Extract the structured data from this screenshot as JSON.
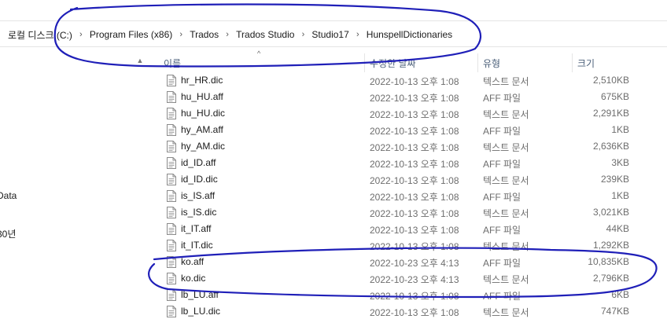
{
  "address": {
    "crumbs": [
      "로컬 디스크 (C:)",
      "Program Files (x86)",
      "Trados",
      "Trados Studio",
      "Studio17",
      "HunspellDictionaries"
    ],
    "separator": "›"
  },
  "nav": {
    "fragment_1": "Data",
    "fragment_2": "30년"
  },
  "columns": {
    "name": "이름",
    "date": "수정한 날짜",
    "type": "유형",
    "size": "크기"
  },
  "files": [
    {
      "name": "hr_HR.dic",
      "date": "2022-10-13 오후 1:08",
      "type": "텍스트 문서",
      "size": "2,510KB"
    },
    {
      "name": "hu_HU.aff",
      "date": "2022-10-13 오후 1:08",
      "type": "AFF 파일",
      "size": "675KB"
    },
    {
      "name": "hu_HU.dic",
      "date": "2022-10-13 오후 1:08",
      "type": "텍스트 문서",
      "size": "2,291KB"
    },
    {
      "name": "hy_AM.aff",
      "date": "2022-10-13 오후 1:08",
      "type": "AFF 파일",
      "size": "1KB"
    },
    {
      "name": "hy_AM.dic",
      "date": "2022-10-13 오후 1:08",
      "type": "텍스트 문서",
      "size": "2,636KB"
    },
    {
      "name": "id_ID.aff",
      "date": "2022-10-13 오후 1:08",
      "type": "AFF 파일",
      "size": "3KB"
    },
    {
      "name": "id_ID.dic",
      "date": "2022-10-13 오후 1:08",
      "type": "텍스트 문서",
      "size": "239KB"
    },
    {
      "name": "is_IS.aff",
      "date": "2022-10-13 오후 1:08",
      "type": "AFF 파일",
      "size": "1KB"
    },
    {
      "name": "is_IS.dic",
      "date": "2022-10-13 오후 1:08",
      "type": "텍스트 문서",
      "size": "3,021KB"
    },
    {
      "name": "it_IT.aff",
      "date": "2022-10-13 오후 1:08",
      "type": "AFF 파일",
      "size": "44KB"
    },
    {
      "name": "it_IT.dic",
      "date": "2022-10-13 오후 1:08",
      "type": "텍스트 문서",
      "size": "1,292KB"
    },
    {
      "name": "ko.aff",
      "date": "2022-10-23 오후 4:13",
      "type": "AFF 파일",
      "size": "10,835KB"
    },
    {
      "name": "ko.dic",
      "date": "2022-10-23 오후 4:13",
      "type": "텍스트 문서",
      "size": "2,796KB"
    },
    {
      "name": "lb_LU.aff",
      "date": "2022-10-13 오후 1:08",
      "type": "AFF 파일",
      "size": "6KB"
    },
    {
      "name": "lb_LU.dic",
      "date": "2022-10-13 오후 1:08",
      "type": "텍스트 문서",
      "size": "747KB"
    }
  ],
  "colors": {
    "marker": "#1f1fb8",
    "header_text": "#4c607a",
    "detail_text": "#6d6d6d"
  }
}
